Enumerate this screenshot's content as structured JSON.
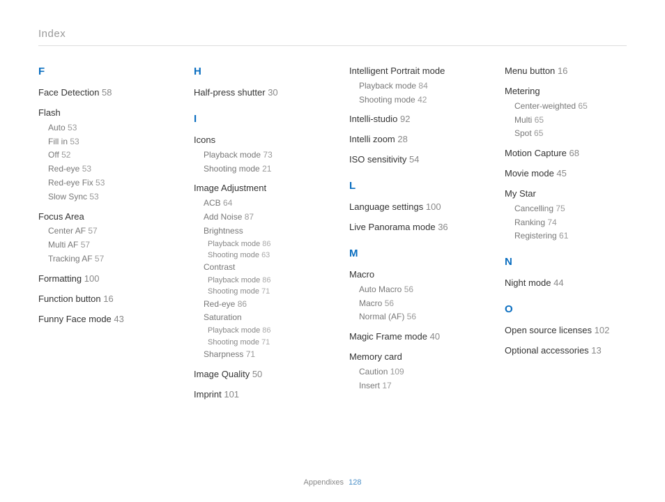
{
  "header": "Index",
  "footer": {
    "label": "Appendixes",
    "page": "128"
  },
  "cols": [
    [
      {
        "type": "letter",
        "text": "F"
      },
      {
        "type": "entry",
        "text": "Face Detection",
        "page": "58"
      },
      {
        "type": "group",
        "title": "Flash",
        "subs": [
          {
            "text": "Auto",
            "page": "53"
          },
          {
            "text": "Fill in",
            "page": "53"
          },
          {
            "text": "Off",
            "page": "52"
          },
          {
            "text": "Red-eye",
            "page": "53"
          },
          {
            "text": "Red-eye Fix",
            "page": "53"
          },
          {
            "text": "Slow Sync",
            "page": "53"
          }
        ]
      },
      {
        "type": "group",
        "title": "Focus Area",
        "subs": [
          {
            "text": "Center AF",
            "page": "57"
          },
          {
            "text": "Multi AF",
            "page": "57"
          },
          {
            "text": "Tracking AF",
            "page": "57"
          }
        ]
      },
      {
        "type": "entry",
        "text": "Formatting",
        "page": "100"
      },
      {
        "type": "entry",
        "text": "Function button",
        "page": "16"
      },
      {
        "type": "entry",
        "text": "Funny Face mode",
        "page": "43"
      }
    ],
    [
      {
        "type": "letter",
        "text": "H"
      },
      {
        "type": "entry",
        "text": "Half-press shutter",
        "page": "30"
      },
      {
        "type": "letter",
        "text": "I"
      },
      {
        "type": "group",
        "title": "Icons",
        "subs": [
          {
            "text": "Playback mode",
            "page": "73"
          },
          {
            "text": "Shooting mode",
            "page": "21"
          }
        ]
      },
      {
        "type": "group",
        "title": "Image Adjustment",
        "subs": [
          {
            "text": "ACB",
            "page": "64"
          },
          {
            "text": "Add Noise",
            "page": "87"
          },
          {
            "text": "Brightness",
            "subsubs": [
              {
                "text": "Playback mode",
                "page": "86"
              },
              {
                "text": "Shooting mode",
                "page": "63"
              }
            ]
          },
          {
            "text": "Contrast",
            "subsubs": [
              {
                "text": "Playback mode",
                "page": "86"
              },
              {
                "text": "Shooting mode",
                "page": "71"
              }
            ]
          },
          {
            "text": "Red-eye",
            "page": "86"
          },
          {
            "text": "Saturation",
            "subsubs": [
              {
                "text": "Playback mode",
                "page": "86"
              },
              {
                "text": "Shooting mode",
                "page": "71"
              }
            ]
          },
          {
            "text": "Sharpness",
            "page": "71"
          }
        ]
      },
      {
        "type": "entry",
        "text": "Image Quality",
        "page": "50"
      },
      {
        "type": "entry",
        "text": "Imprint",
        "page": "101"
      }
    ],
    [
      {
        "type": "group",
        "title": "Intelligent Portrait mode",
        "subs": [
          {
            "text": "Playback mode",
            "page": "84"
          },
          {
            "text": "Shooting mode",
            "page": "42"
          }
        ]
      },
      {
        "type": "entry",
        "text": "Intelli-studio",
        "page": "92"
      },
      {
        "type": "entry",
        "text": "Intelli zoom",
        "page": "28"
      },
      {
        "type": "entry",
        "text": "ISO sensitivity",
        "page": "54"
      },
      {
        "type": "letter",
        "text": "L"
      },
      {
        "type": "entry",
        "text": "Language settings",
        "page": "100"
      },
      {
        "type": "entry",
        "text": "Live Panorama mode",
        "page": "36"
      },
      {
        "type": "letter",
        "text": "M"
      },
      {
        "type": "group",
        "title": "Macro",
        "subs": [
          {
            "text": "Auto Macro",
            "page": "56"
          },
          {
            "text": "Macro",
            "page": "56"
          },
          {
            "text": "Normal (AF)",
            "page": "56"
          }
        ]
      },
      {
        "type": "entry",
        "text": "Magic Frame mode",
        "page": "40"
      },
      {
        "type": "group",
        "title": "Memory card",
        "subs": [
          {
            "text": "Caution",
            "page": "109"
          },
          {
            "text": "Insert",
            "page": "17"
          }
        ]
      }
    ],
    [
      {
        "type": "entry",
        "text": "Menu button",
        "page": "16"
      },
      {
        "type": "group",
        "title": "Metering",
        "subs": [
          {
            "text": "Center-weighted",
            "page": "65"
          },
          {
            "text": "Multi",
            "page": "65"
          },
          {
            "text": "Spot",
            "page": "65"
          }
        ]
      },
      {
        "type": "entry",
        "text": "Motion Capture",
        "page": "68"
      },
      {
        "type": "entry",
        "text": "Movie mode",
        "page": "45"
      },
      {
        "type": "group",
        "title": "My Star",
        "subs": [
          {
            "text": "Cancelling",
            "page": "75"
          },
          {
            "text": "Ranking",
            "page": "74"
          },
          {
            "text": "Registering",
            "page": "61"
          }
        ]
      },
      {
        "type": "letter",
        "text": "N"
      },
      {
        "type": "entry",
        "text": "Night mode",
        "page": "44"
      },
      {
        "type": "letter",
        "text": "O"
      },
      {
        "type": "entry",
        "text": "Open source licenses",
        "page": "102"
      },
      {
        "type": "entry",
        "text": "Optional accessories",
        "page": "13"
      }
    ]
  ]
}
